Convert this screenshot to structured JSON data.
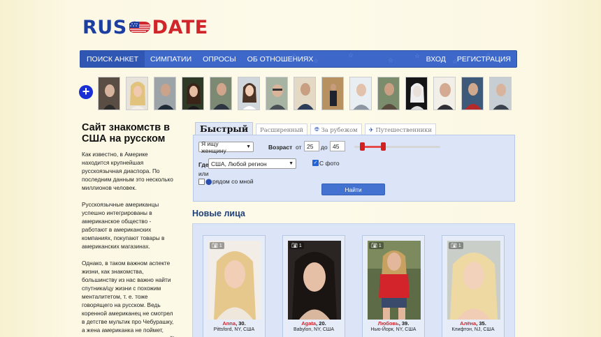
{
  "logo": {
    "part1": "RUS",
    "part2": "DATE"
  },
  "nav": {
    "items": [
      "ПОИСК АНКЕТ",
      "СИМПАТИИ",
      "ОПРОСЫ",
      "ОБ ОТНОШЕНИЯХ"
    ],
    "right": [
      "ВХОД",
      "РЕГИСТРАЦИЯ"
    ]
  },
  "thumb_strip": {
    "add_label": "+",
    "count": 15
  },
  "sidebar": {
    "title": "Сайт знакомств в США на русском",
    "paragraphs": [
      "Как известно, в Америке находится крупнейшая русскоязычная диаспора. По последним данным это несколько миллионов человек.",
      "Русскоязычные американцы успешно интегрированы в американское общество - работают в американских компаниях, покупают товары в американских магазинах.",
      "Однако, в таком важном аспекте жизни, как знакомства, большинству из нас важно найти спутника/цу жизни с похожим менталитетом, т. е. тоже говорящего на русском. Ведь коренной американец не смотрел в детстве мультик про Чебурашку, а жена американка не поймет, почему вы макаете печенье в чай)"
    ]
  },
  "search": {
    "tabs": [
      "Быстрый",
      "Расширенный",
      "За рубежом",
      "Путешественники"
    ],
    "seeking": "Я ищу женщину",
    "age_label": "Возраст",
    "from_label": "от",
    "age_from": "25",
    "to_label": "до",
    "age_to": "45",
    "age_range": [
      25,
      45
    ],
    "where_label": "Где",
    "region": "США, Любой регион",
    "photo_label": "С фото",
    "photo_checked": true,
    "or_label": "или",
    "nearby_label": "рядом со мной",
    "nearby_checked": false,
    "submit": "Найти"
  },
  "new_faces": {
    "title": "Новые лица",
    "cards": [
      {
        "photos": "1",
        "name": "Anna",
        "age": "30",
        "location": "Pittsford, NY, США"
      },
      {
        "photos": "1",
        "name": "Agata",
        "age": "20",
        "location": "Babylon, NY, США"
      },
      {
        "photos": "1",
        "name": "Любовь",
        "age": "39",
        "location": "Нью-Йорк, NY, США"
      },
      {
        "photos": "1",
        "name": "Алёна",
        "age": "35",
        "location": "Клифтон, NJ, США"
      }
    ]
  },
  "colors": {
    "nav_bg": "#3d67c9",
    "accent_red": "#d0252b",
    "panel_bg": "#dbe5f7",
    "title_blue": "#1d3f7a"
  }
}
